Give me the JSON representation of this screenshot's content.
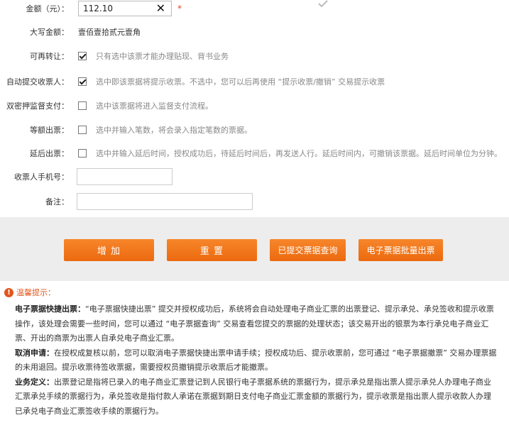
{
  "form": {
    "amount": {
      "label": "金额（元）：",
      "value": "112.10",
      "required_mark": "*"
    },
    "amount_upper": {
      "label": "大写金额：",
      "value": "壹佰壹拾贰元壹角"
    },
    "transferable": {
      "label": "可再转让：",
      "checked": true,
      "hint": "只有选中该票才能办理贴现、背书业务"
    },
    "auto_submit": {
      "label": "自动提交收票人：",
      "checked": true,
      "hint": "选中即该票据将提示收票。不选中，您可以后再使用 “提示收票/撤销” 交易提示收票"
    },
    "dual_password": {
      "label": "双密押监督支付：",
      "checked": false,
      "hint": "选中该票据将进入监督支付流程。"
    },
    "equal_amount": {
      "label": "等额出票：",
      "checked": false,
      "hint": "选中并输入笔数，将会录入指定笔数的票据。"
    },
    "delayed": {
      "label": "延后出票：",
      "checked": false,
      "hint": "选中并输入延后时间，授权成功后，待延后时间后，再发送人行。延后时间内，可撤销该票据。延后时间单位为分钟。"
    },
    "phone": {
      "label": "收票人手机号：",
      "value": ""
    },
    "remark": {
      "label": "备注：",
      "value": ""
    }
  },
  "buttons": {
    "add": "增 加",
    "reset": "重 置",
    "query": "已提交票据查询",
    "batch": "电子票据批量出票"
  },
  "tips": {
    "title": "温馨提示：",
    "p1_head": "电子票据快捷出票：",
    "p1_body": "“电子票据快捷出票” 提交并授权成功后，系统将会自动处理电子商业汇票的出票登记、提示承兑、承兑签收和提示收票操作，该处理会需要一些时间，您可以通过 “电子票据查询” 交易查看您提交的票据的处理状态；该交易开出的银票为本行承兑电子商业汇票、开出的商票为出票人自承兑电子商业汇票。",
    "p2_head": "取消申请：",
    "p2_body": "在授权成复核以前，您可以取消电子票据快捷出票申请手续；授权成功后、提示收票前，您可通过 “电子票据撤票” 交易办理票据的未用退回。提示收票待签收票据，需要授权员撤销提示收票后才能撤票。",
    "p3_head": "业务定义：",
    "p3_body": "出票登记是指将已录入的电子商业汇票登记到人民银行电子票据系统的票据行为，提示承兑是指出票人提示承兑人办理电子商业汇票承兑手续的票据行为，承兑签收是指付款人承诺在票据到期日支付电子商业汇票金额的票据行为，提示收票是指出票人提示收款人办理已承兑电子商业汇票签收手续的票据行为。"
  },
  "colors": {
    "accent": "#ec6a10",
    "tip": "#e2561c",
    "hint": "#888888",
    "panel": "#ededed"
  }
}
